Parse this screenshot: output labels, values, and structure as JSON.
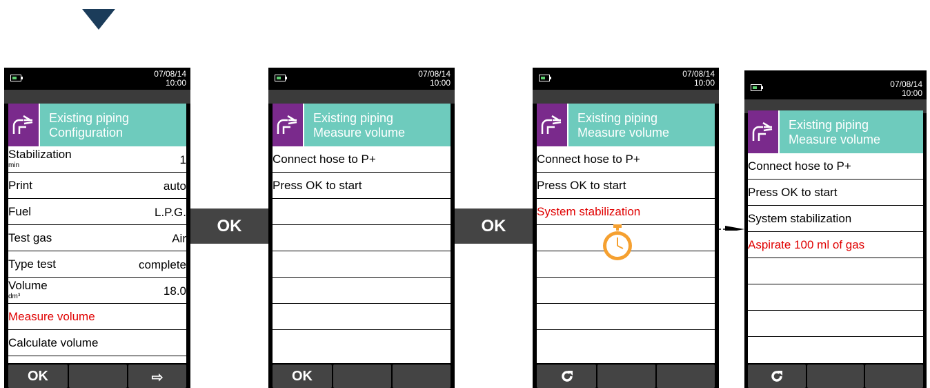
{
  "screens": [
    {
      "date": "07/08/14",
      "time": "10:00",
      "header_line1": "Existing piping",
      "header_line2": "Configuration",
      "rows": [
        {
          "label": "Stabilization",
          "unit": "min",
          "value": "1"
        },
        {
          "label": "Print",
          "value": "auto"
        },
        {
          "label": "Fuel",
          "value": "L.P.G."
        },
        {
          "label": "Test gas",
          "value": "Air"
        },
        {
          "label": "Type test",
          "value": "complete"
        },
        {
          "label": "Volume",
          "unit": "dm³",
          "value": "18.0"
        },
        {
          "label": "Measure volume",
          "highlighted": true
        },
        {
          "label": "Calculate volume"
        }
      ],
      "footer_buttons": [
        "OK",
        "",
        "⇨"
      ]
    },
    {
      "date": "07/08/14",
      "time": "10:00",
      "header_line1": "Existing piping",
      "header_line2": "Measure volume",
      "rows": [
        {
          "label": "Connect hose to P+"
        },
        {
          "label": "Press OK to start"
        },
        {
          "label": ""
        },
        {
          "label": ""
        },
        {
          "label": ""
        },
        {
          "label": ""
        },
        {
          "label": ""
        }
      ],
      "footer_buttons": [
        "OK",
        "",
        ""
      ]
    },
    {
      "date": "07/08/14",
      "time": "10:00",
      "header_line1": "Existing piping",
      "header_line2": "Measure volume",
      "rows": [
        {
          "label": "Connect hose to P+"
        },
        {
          "label": "Press OK to start"
        },
        {
          "label": "System stabilization",
          "highlighted": true
        },
        {
          "label": ""
        },
        {
          "label": ""
        },
        {
          "label": ""
        },
        {
          "label": ""
        }
      ],
      "footer_buttons": [
        "refresh-icon",
        "",
        ""
      ]
    },
    {
      "date": "07/08/14",
      "time": "10:00",
      "header_line1": "Existing piping",
      "header_line2": "Measure volume",
      "rows": [
        {
          "label": "Connect hose to P+"
        },
        {
          "label": "Press OK to start"
        },
        {
          "label": "System stabilization"
        },
        {
          "label": "Aspirate 100 ml of gas",
          "highlighted": true
        },
        {
          "label": ""
        },
        {
          "label": ""
        },
        {
          "label": ""
        }
      ],
      "footer_buttons": [
        "refresh-icon",
        "",
        ""
      ]
    }
  ],
  "ok_buttons": [
    "OK",
    "OK"
  ],
  "colors": {
    "header_teal": "#6ecbbd",
    "icon_purple": "#7a2a8c",
    "highlight_red": "#e00000",
    "timer_orange": "#f5a030"
  }
}
